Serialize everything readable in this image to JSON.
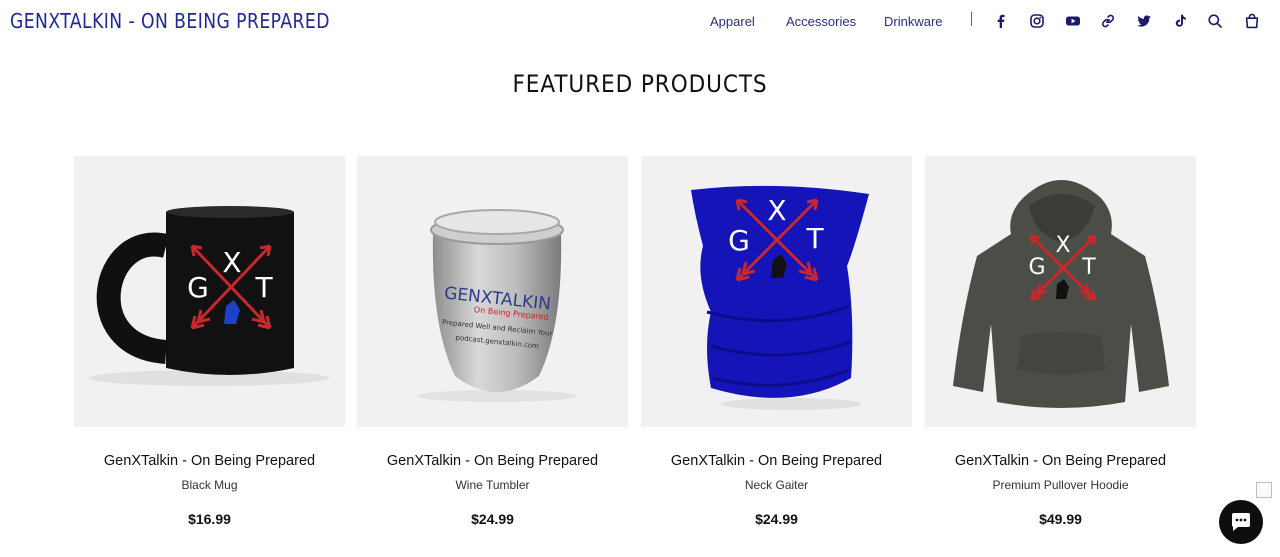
{
  "header": {
    "brand": "GENXTALKIN - ON BEING PREPARED",
    "nav": [
      "Apparel",
      "Accessories",
      "Drinkware"
    ],
    "icons": [
      "facebook-icon",
      "instagram-icon",
      "youtube-icon",
      "link-icon",
      "twitter-icon",
      "tiktok-icon",
      "search-icon",
      "cart-icon"
    ]
  },
  "section": {
    "title": "FEATURED PRODUCTS"
  },
  "products": [
    {
      "title": "GenXTalkin - On Being Prepared",
      "subtitle": "Black Mug",
      "price": "$16.99"
    },
    {
      "title": "GenXTalkin - On Being Prepared",
      "subtitle": "Wine Tumbler",
      "price": "$24.99"
    },
    {
      "title": "GenXTalkin - On Being Prepared",
      "subtitle": "Neck Gaiter",
      "price": "$24.99"
    },
    {
      "title": "GenXTalkin - On Being Prepared",
      "subtitle": "Premium Pullover Hoodie",
      "price": "$49.99"
    }
  ],
  "artwork": {
    "logo_letters": [
      "G",
      "X",
      "T"
    ],
    "tumbler_brand": "GENXTALKIN",
    "tumbler_tagline": "On Being Prepared",
    "tumbler_line": "Prepared Well and Reclaim Your",
    "tumbler_url": "podcast.genxtalkin.com"
  },
  "colors": {
    "brand": "#1f2a8f",
    "arrow_red": "#c8282c",
    "gaiter_blue": "#1414b8",
    "hoodie_gray": "#4b4e47"
  }
}
